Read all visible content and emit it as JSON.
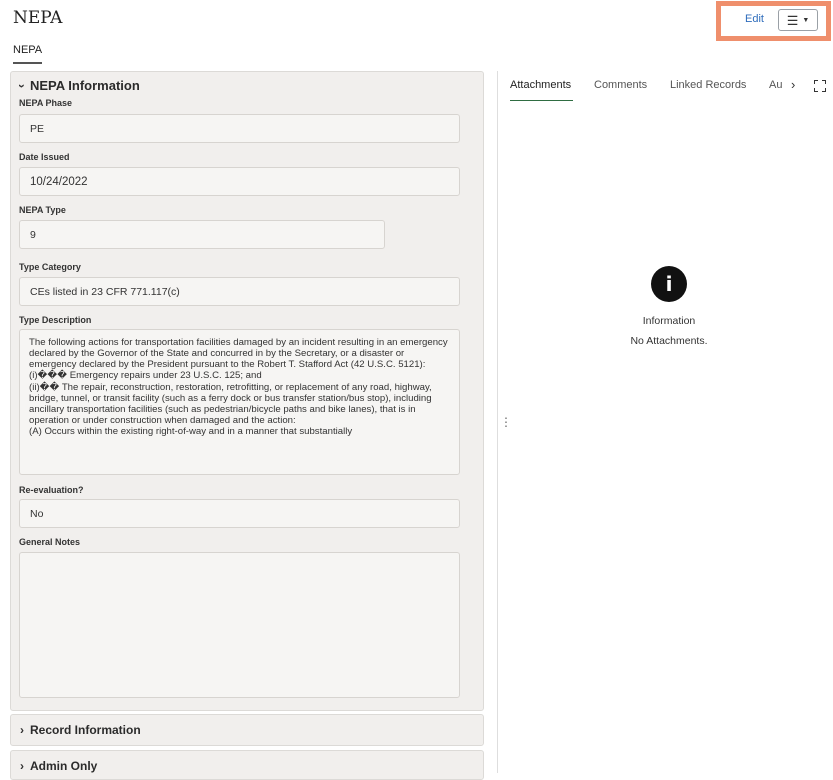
{
  "header": {
    "title": "NEPA",
    "edit_label": "Edit",
    "menu_icon": "hamburger-menu-icon"
  },
  "subtab": {
    "label": "NEPA"
  },
  "nepa_section": {
    "title": "NEPA Information",
    "fields": {
      "phase": {
        "label": "NEPA Phase",
        "value": "PE"
      },
      "date_issued": {
        "label": "Date Issued",
        "value": "10/24/2022"
      },
      "type": {
        "label": "NEPA Type",
        "value": "9"
      },
      "type_category": {
        "label": "Type Category",
        "value": "CEs listed in 23 CFR 771.117(c)"
      },
      "type_description": {
        "label": "Type Description",
        "value": "The following actions for transportation facilities damaged by an incident resulting in an emergency declared by the Governor of the State and concurred in by the Secretary, or a disaster or emergency declared by the President pursuant to the Robert T. Stafford Act (42 U.S.C. 5121):\n(i)��� Emergency repairs under 23 U.S.C. 125; and\n(ii)�� The repair, reconstruction, restoration, retrofitting, or replacement of any road, highway, bridge, tunnel, or transit facility (such as a ferry dock or bus transfer station/bus stop), including ancillary transportation facilities (such as pedestrian/bicycle paths and bike lanes), that is in operation or under construction when damaged and the action:\n(A) Occurs within the existing right-of-way and in a manner that substantially"
      },
      "reevaluation": {
        "label": "Re-evaluation?",
        "value": "No"
      },
      "general_notes": {
        "label": "General Notes",
        "value": ""
      }
    }
  },
  "collapsed_sections": [
    {
      "title": "Record Information"
    },
    {
      "title": "Admin Only"
    }
  ],
  "right_panel": {
    "tabs": [
      "Attachments",
      "Comments",
      "Linked Records",
      "Au"
    ],
    "active_tab": "Attachments",
    "info_title": "Information",
    "info_message": "No Attachments."
  },
  "colors": {
    "highlight": "#ef8f6c",
    "link": "#2f6dbc",
    "active_tab_underline": "#2f6d42"
  }
}
